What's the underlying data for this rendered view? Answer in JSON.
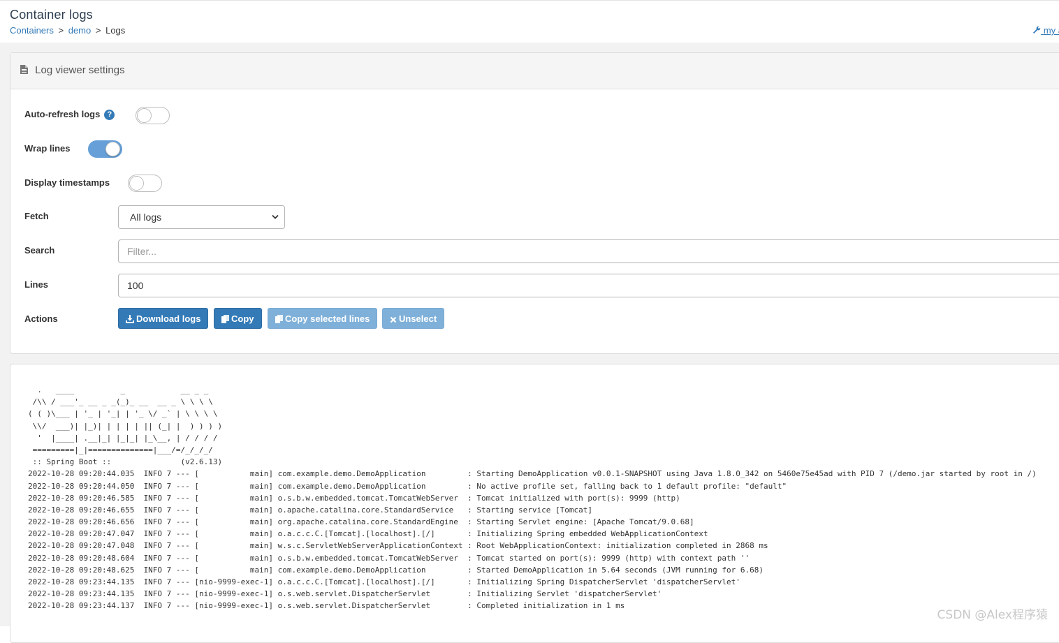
{
  "header": {
    "title": "Container logs",
    "breadcrumb": {
      "containers": "Containers",
      "sep1": ">",
      "demo": "demo",
      "sep2": ">",
      "current": "Logs"
    },
    "account": "my a"
  },
  "settings": {
    "title": "Log viewer settings",
    "auto_refresh_label": "Auto-refresh logs",
    "auto_refresh_on": false,
    "wrap_lines_label": "Wrap lines",
    "wrap_lines_on": true,
    "timestamps_label": "Display timestamps",
    "timestamps_on": false,
    "fetch_label": "Fetch",
    "fetch_value": "All logs",
    "search_label": "Search",
    "search_placeholder": "Filter...",
    "lines_label": "Lines",
    "lines_value": "100",
    "actions_label": "Actions",
    "buttons": {
      "download": "Download logs",
      "copy": "Copy",
      "copy_selected": "Copy selected lines",
      "unselect": "Unselect"
    }
  },
  "logs": {
    "lines": [
      "  .   ____          _            __ _ _",
      " /\\\\ / ___'_ __ _ _(_)_ __  __ _ \\ \\ \\ \\",
      "( ( )\\___ | '_ | '_| | '_ \\/ _` | \\ \\ \\ \\",
      " \\\\/  ___)| |_)| | | | | || (_| |  ) ) ) )",
      "  '  |____| .__|_| |_|_| |_\\__, | / / / /",
      " =========|_|==============|___/=/_/_/_/",
      " :: Spring Boot ::               (v2.6.13)",
      "2022-10-28 09:20:44.035  INFO 7 --- [           main] com.example.demo.DemoApplication         : Starting DemoApplication v0.0.1-SNAPSHOT using Java 1.8.0_342 on 5460e75e45ad with PID 7 (/demo.jar started by root in /)",
      "2022-10-28 09:20:44.050  INFO 7 --- [           main] com.example.demo.DemoApplication         : No active profile set, falling back to 1 default profile: \"default\"",
      "2022-10-28 09:20:46.585  INFO 7 --- [           main] o.s.b.w.embedded.tomcat.TomcatWebServer  : Tomcat initialized with port(s): 9999 (http)",
      "2022-10-28 09:20:46.655  INFO 7 --- [           main] o.apache.catalina.core.StandardService   : Starting service [Tomcat]",
      "2022-10-28 09:20:46.656  INFO 7 --- [           main] org.apache.catalina.core.StandardEngine  : Starting Servlet engine: [Apache Tomcat/9.0.68]",
      "2022-10-28 09:20:47.047  INFO 7 --- [           main] o.a.c.c.C.[Tomcat].[localhost].[/]       : Initializing Spring embedded WebApplicationContext",
      "2022-10-28 09:20:47.048  INFO 7 --- [           main] w.s.c.ServletWebServerApplicationContext : Root WebApplicationContext: initialization completed in 2868 ms",
      "2022-10-28 09:20:48.604  INFO 7 --- [           main] o.s.b.w.embedded.tomcat.TomcatWebServer  : Tomcat started on port(s): 9999 (http) with context path ''",
      "2022-10-28 09:20:48.625  INFO 7 --- [           main] com.example.demo.DemoApplication         : Started DemoApplication in 5.64 seconds (JVM running for 6.68)",
      "2022-10-28 09:23:44.135  INFO 7 --- [nio-9999-exec-1] o.a.c.c.C.[Tomcat].[localhost].[/]       : Initializing Spring DispatcherServlet 'dispatcherServlet'",
      "2022-10-28 09:23:44.135  INFO 7 --- [nio-9999-exec-1] o.s.web.servlet.DispatcherServlet        : Initializing Servlet 'dispatcherServlet'",
      "2022-10-28 09:23:44.137  INFO 7 --- [nio-9999-exec-1] o.s.web.servlet.DispatcherServlet        : Completed initialization in 1 ms"
    ]
  },
  "watermark": "CSDN @Alex程序猿",
  "colors": {
    "primary": "#337ab7",
    "disabled": "#7fb0d9",
    "switch_on": "#67a0d8"
  }
}
